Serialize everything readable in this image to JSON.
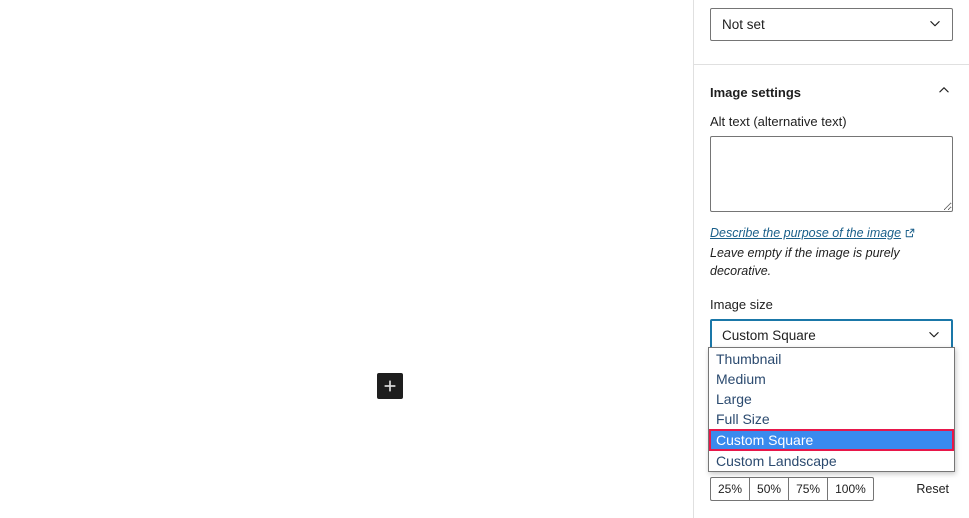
{
  "canvas": {
    "inserter_label": "+",
    "inserter_icon": "plus-icon"
  },
  "sidebar": {
    "top_select": {
      "value": "Not set",
      "chevron_icon": "chevron-down-icon"
    },
    "image_settings": {
      "title": "Image settings",
      "collapse_icon": "chevron-up-icon",
      "alt_text": {
        "label": "Alt text (alternative text)",
        "value": "",
        "placeholder": ""
      },
      "help": {
        "link_text": "Describe the purpose of the image",
        "external_icon": "external-link-icon",
        "rest_text": " Leave empty if the image is purely decorative."
      },
      "image_size": {
        "label": "Image size",
        "value": "Custom Square",
        "chevron_icon": "chevron-down-icon",
        "options": [
          "Thumbnail",
          "Medium",
          "Large",
          "Full Size",
          "Custom Square",
          "Custom Landscape"
        ],
        "selected_index": 4
      },
      "scale_buttons": [
        "25%",
        "50%",
        "75%",
        "100%"
      ],
      "reset_label": "Reset"
    }
  },
  "colors": {
    "highlight_bg": "#3a8aee",
    "highlight_outline": "#e8174a",
    "focus_border": "#1a77a8",
    "link": "#1a5f8a",
    "inserter_bg": "#1e1e1e"
  }
}
